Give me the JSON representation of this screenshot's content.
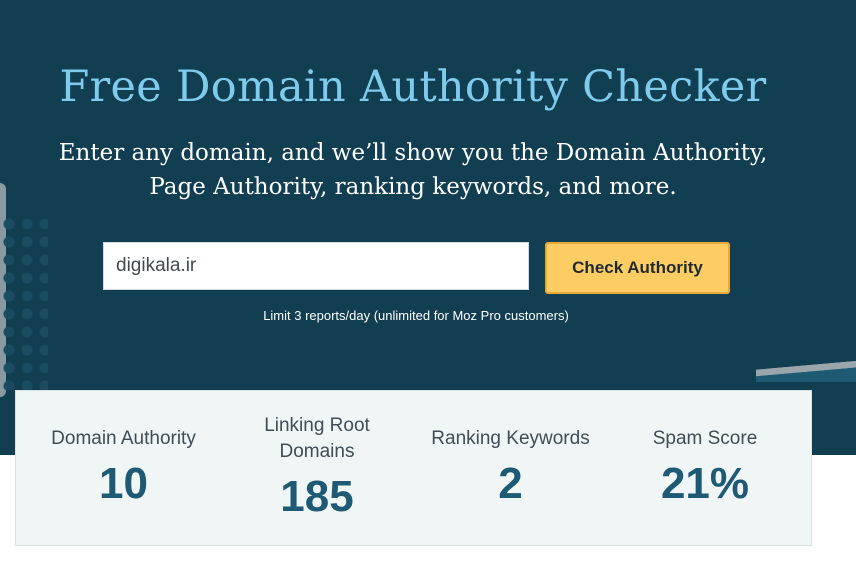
{
  "hero": {
    "title": "Free Domain Authority Checker",
    "subtitle_line1": "Enter any domain, and we’ll show you the Domain Authority,",
    "subtitle_line2": "Page Authority, ranking keywords, and more."
  },
  "search": {
    "value": "digikala.ir",
    "button_label": "Check Authority",
    "limit_note": "Limit 3 reports/day (unlimited for Moz Pro customers)"
  },
  "stats": [
    {
      "label_line1": "Domain Authority",
      "label_line2": "",
      "value": "10"
    },
    {
      "label_line1": "Linking Root",
      "label_line2": "Domains",
      "value": "185"
    },
    {
      "label_line1": "Ranking Keywords",
      "label_line2": "",
      "value": "2"
    },
    {
      "label_line1": "Spam Score",
      "label_line2": "",
      "value": "21%"
    }
  ],
  "colors": {
    "hero_bg": "#123e51",
    "title": "#7fcbed",
    "button": "#fdcc63",
    "stat_value": "#1e5a74",
    "stats_bg": "#f0f5f6"
  }
}
